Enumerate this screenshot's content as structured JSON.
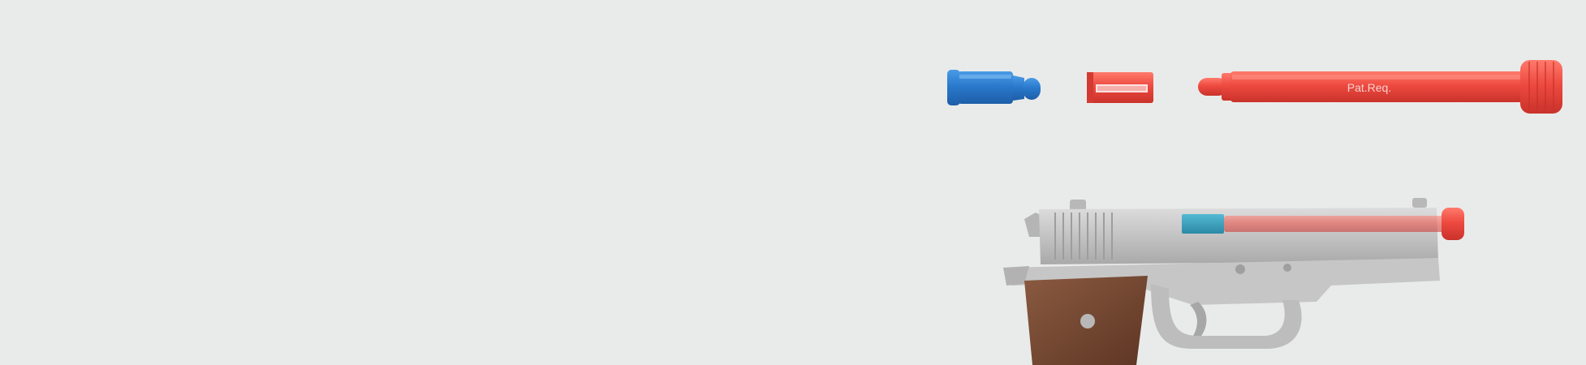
{
  "image": {
    "background": "#e9ebea",
    "parts": {
      "dummy_round": {
        "label": "",
        "color": "#2f7fd1",
        "icon": "dummy-round-icon"
      },
      "sleeve": {
        "label": "",
        "color": "#e84b43",
        "icon": "barrel-sleeve-icon"
      },
      "indicator_rod": {
        "label": "Pat.Req.",
        "color": "#ee4a40",
        "icon": "indicator-rod-icon"
      }
    },
    "pistol": {
      "label": "",
      "icon": "pistol-icon",
      "slide_color": "#c9c9c9",
      "grip_color": "#7a4a33"
    }
  }
}
